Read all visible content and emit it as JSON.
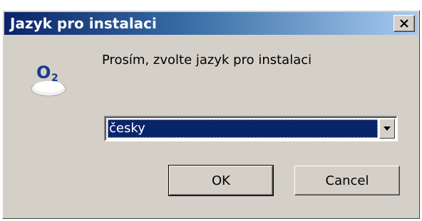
{
  "window": {
    "title": "Jazyk pro instalaci",
    "close_label": "×"
  },
  "icon": {
    "name": "o2-logo-icon",
    "text_o": "O",
    "text_sub": "2"
  },
  "prompt": "Prosím, zvolte jazyk pro instalaci",
  "language_select": {
    "selected": "česky"
  },
  "buttons": {
    "ok": "OK",
    "cancel": "Cancel"
  },
  "colors": {
    "titlebar_start": "#0a246a",
    "titlebar_end": "#a6caf0",
    "dialog_bg": "#d4d0c8",
    "selection_bg": "#0a246a"
  }
}
